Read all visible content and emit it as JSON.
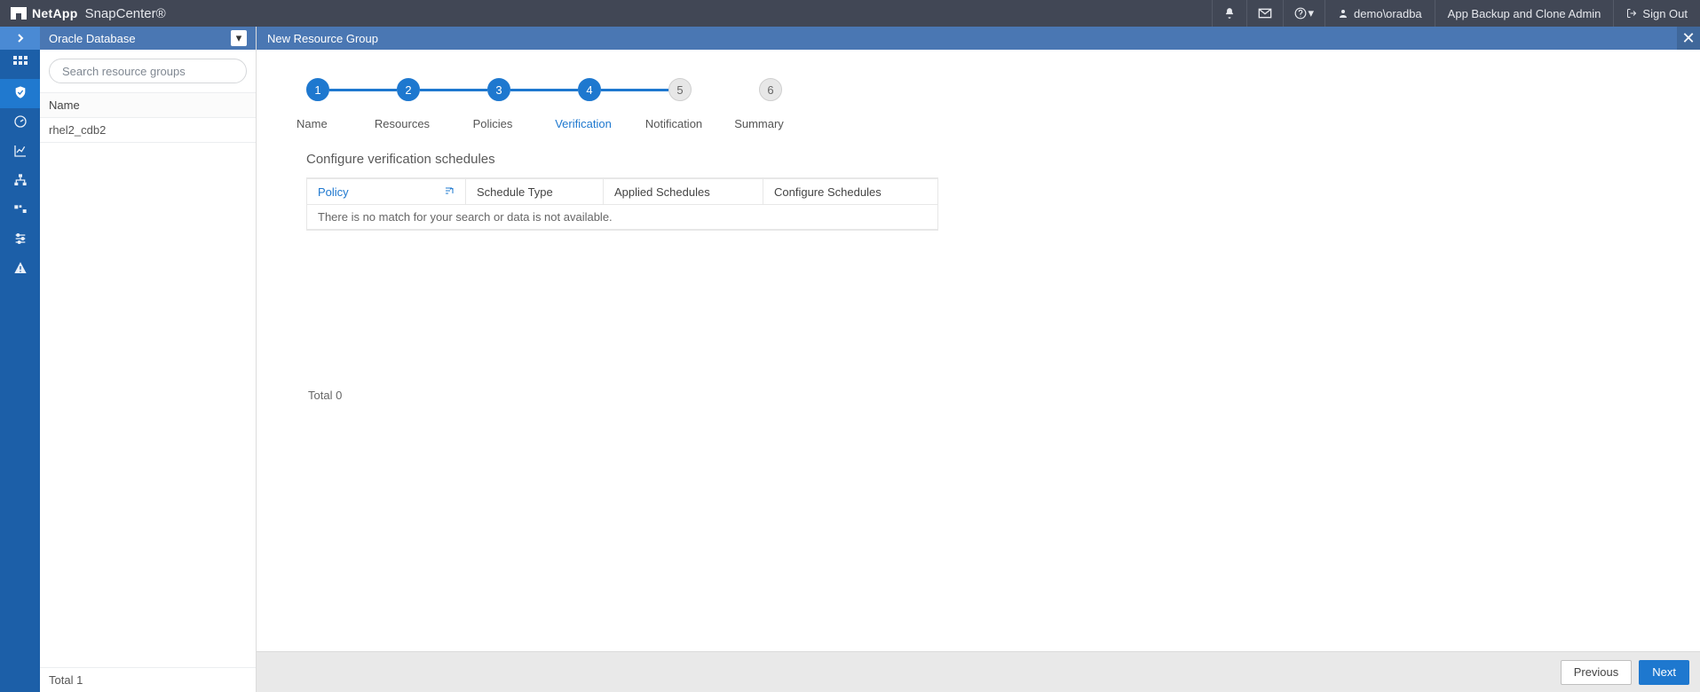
{
  "brand": {
    "company": "NetApp",
    "product": "SnapCenter®"
  },
  "header": {
    "user": "demo\\oradba",
    "role": "App Backup and Clone Admin",
    "signout": "Sign Out"
  },
  "sidebar": {
    "plugin_label": "Oracle Database",
    "search_placeholder": "Search resource groups",
    "column_header": "Name",
    "rows": [
      "rhel2_cdb2"
    ],
    "total_text": "Total 1"
  },
  "wizard": {
    "title": "New Resource Group",
    "steps": [
      {
        "num": "1",
        "label": "Name",
        "state": "done"
      },
      {
        "num": "2",
        "label": "Resources",
        "state": "done"
      },
      {
        "num": "3",
        "label": "Policies",
        "state": "done"
      },
      {
        "num": "4",
        "label": "Verification",
        "state": "done",
        "current": true
      },
      {
        "num": "5",
        "label": "Notification",
        "state": "future"
      },
      {
        "num": "6",
        "label": "Summary",
        "state": "future"
      }
    ],
    "section_title": "Configure verification schedules",
    "columns": {
      "policy": "Policy",
      "type": "Schedule Type",
      "applied": "Applied Schedules",
      "config": "Configure Schedules"
    },
    "empty_text": "There is no match for your search or data is not available.",
    "total_text": "Total 0",
    "prev": "Previous",
    "next": "Next"
  }
}
